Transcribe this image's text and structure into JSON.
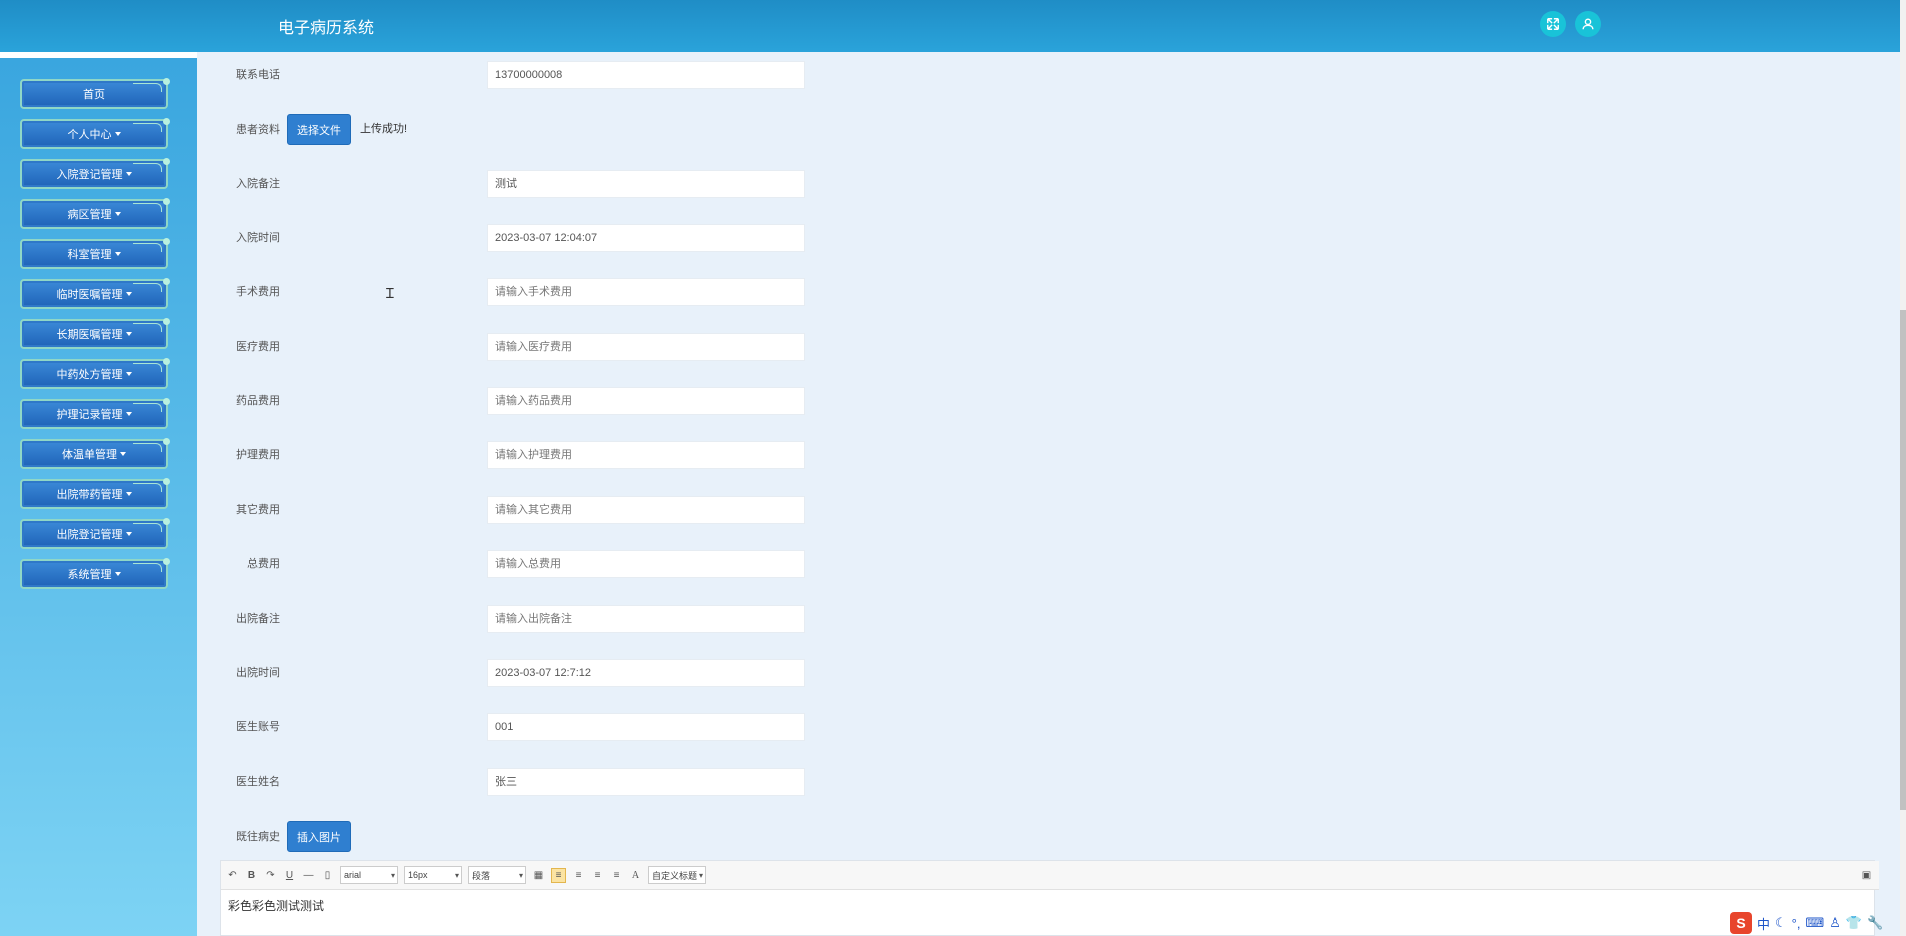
{
  "header": {
    "title": "电子病历系统",
    "icons": [
      "fullscreen-icon",
      "user-icon"
    ]
  },
  "sidebar": {
    "items": [
      {
        "label": "首页",
        "has_caret": false
      },
      {
        "label": "个人中心",
        "has_caret": true
      },
      {
        "label": "入院登记管理",
        "has_caret": true
      },
      {
        "label": "病区管理",
        "has_caret": true
      },
      {
        "label": "科室管理",
        "has_caret": true
      },
      {
        "label": "临时医嘱管理",
        "has_caret": true
      },
      {
        "label": "长期医嘱管理",
        "has_caret": true
      },
      {
        "label": "中药处方管理",
        "has_caret": true
      },
      {
        "label": "护理记录管理",
        "has_caret": true
      },
      {
        "label": "体温单管理",
        "has_caret": true
      },
      {
        "label": "出院带药管理",
        "has_caret": true
      },
      {
        "label": "出院登记管理",
        "has_caret": true
      },
      {
        "label": "系统管理",
        "has_caret": true
      }
    ]
  },
  "form": {
    "phone": {
      "label": "联系电话",
      "value": "13700000008"
    },
    "patient_file": {
      "label": "患者资料",
      "button": "选择文件",
      "status": "上传成功!"
    },
    "admission_note": {
      "label": "入院备注",
      "value": "测试"
    },
    "admission_time": {
      "label": "入院时间",
      "value": "2023-03-07 12:04:07"
    },
    "surgery_fee": {
      "label": "手术费用",
      "placeholder": "请输入手术费用"
    },
    "medical_fee": {
      "label": "医疗费用",
      "placeholder": "请输入医疗费用"
    },
    "drug_fee": {
      "label": "药品费用",
      "placeholder": "请输入药品费用"
    },
    "nursing_fee": {
      "label": "护理费用",
      "placeholder": "请输入护理费用"
    },
    "other_fee": {
      "label": "其它费用",
      "placeholder": "请输入其它费用"
    },
    "total_fee": {
      "label": "总费用",
      "placeholder": "请输入总费用"
    },
    "discharge_note": {
      "label": "出院备注",
      "placeholder": "请输入出院备注"
    },
    "discharge_time": {
      "label": "出院时间",
      "value": "2023-03-07 12:7:12"
    },
    "doctor_account": {
      "label": "医生账号",
      "value": "001"
    },
    "doctor_name": {
      "label": "医生姓名",
      "value": "张三"
    },
    "history": {
      "label": "既往病史",
      "button": "插入图片"
    }
  },
  "editor": {
    "font_family": "arial",
    "font_size": "16px",
    "paragraph": "段落",
    "custom_title": "自定义标题",
    "content": "彩色彩色测试测试"
  },
  "ime": {
    "logo": "S",
    "mode": "中"
  }
}
